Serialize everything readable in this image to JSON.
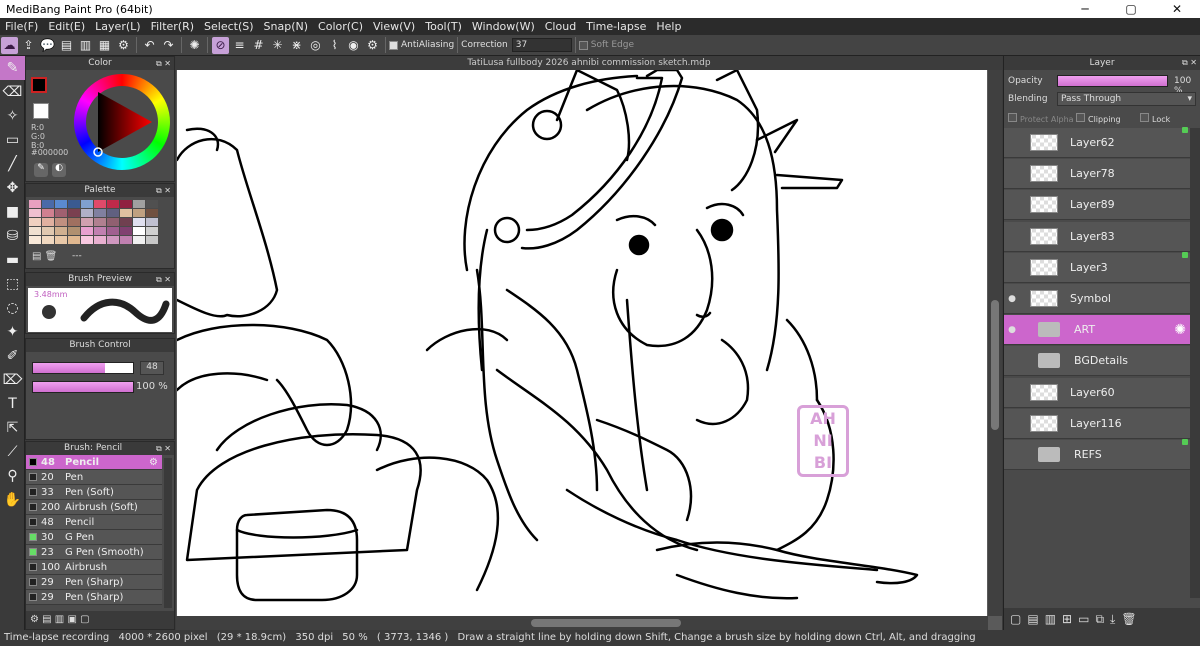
{
  "app": {
    "title": "MediBang Paint Pro (64bit)"
  },
  "menu": [
    "File(F)",
    "Edit(E)",
    "Layer(L)",
    "Filter(R)",
    "Select(S)",
    "Snap(N)",
    "Color(C)",
    "View(V)",
    "Tool(T)",
    "Window(W)",
    "Cloud",
    "Time-lapse",
    "Help"
  ],
  "toolbar": {
    "antialias_label": "AntiAliasing",
    "correction_label": "Correction",
    "correction_value": "37",
    "softedge_label": "Soft Edge"
  },
  "panels": {
    "color": {
      "title": "Color",
      "r": "R:0",
      "g": "G:0",
      "b": "B:0",
      "hex": "#000000"
    },
    "palette": {
      "title": "Palette",
      "more": "---"
    },
    "brush_preview": {
      "title": "Brush Preview",
      "size": "3.48mm"
    },
    "brush_control": {
      "title": "Brush Control",
      "size_value": "48",
      "opacity_value": "100 %"
    },
    "brush_list": {
      "title": "Brush: Pencil"
    }
  },
  "brushes": [
    {
      "size": "48",
      "name": "Pencil",
      "swatch": "#000000",
      "selected": true
    },
    {
      "size": "20",
      "name": "Pen",
      "swatch": "#222222"
    },
    {
      "size": "33",
      "name": "Pen (Soft)",
      "swatch": "#222222"
    },
    {
      "size": "200",
      "name": "Airbrush (Soft)",
      "swatch": "#222222"
    },
    {
      "size": "48",
      "name": "Pencil",
      "swatch": "#222222"
    },
    {
      "size": "30",
      "name": "G Pen",
      "swatch": "#66dd66"
    },
    {
      "size": "23",
      "name": "G Pen (Smooth)",
      "swatch": "#66dd66"
    },
    {
      "size": "100",
      "name": "Airbrush",
      "swatch": "#222222"
    },
    {
      "size": "29",
      "name": "Pen (Sharp)",
      "swatch": "#222222"
    },
    {
      "size": "29",
      "name": "Pen (Sharp)",
      "swatch": "#222222"
    }
  ],
  "canvas": {
    "doc_title": "TatiLusa fullbody 2026 ahnibi commission sketch.mdp",
    "watermark": [
      "AH",
      "NI",
      "BI"
    ]
  },
  "layers_panel": {
    "title": "Layer",
    "opacity_label": "Opacity",
    "opacity_value": "100 %",
    "blending_label": "Blending",
    "blending_value": "Pass Through",
    "protect_alpha": "Protect Alpha",
    "clipping": "Clipping",
    "lock": "Lock"
  },
  "layers": [
    {
      "name": "Layer62",
      "type": "layer",
      "green": true
    },
    {
      "name": "Layer78",
      "type": "layer"
    },
    {
      "name": "Layer89",
      "type": "layer"
    },
    {
      "name": "Layer83",
      "type": "layer"
    },
    {
      "name": "Layer3",
      "type": "layer",
      "green": true
    },
    {
      "name": "Symbol",
      "type": "layer",
      "visible": true
    },
    {
      "name": "ART",
      "type": "folder",
      "visible": true,
      "selected": true
    },
    {
      "name": "BGDetails",
      "type": "folder"
    },
    {
      "name": "Layer60",
      "type": "layer"
    },
    {
      "name": "Layer116",
      "type": "layer"
    },
    {
      "name": "REFS",
      "type": "folder",
      "green": true
    }
  ],
  "status": {
    "mode": "Time-lapse recording",
    "size": "4000 * 2600 pixel",
    "cm": "(29 * 18.9cm)",
    "dpi": "350 dpi",
    "zoom": "50 %",
    "coords": "( 3773, 1346 )",
    "hint": "Draw a straight line by holding down Shift, Change a brush size by holding down Ctrl, Alt, and dragging"
  },
  "colors": {
    "accent": "#cc66cc",
    "primary": "#000000",
    "secondary": "#e0a0e0"
  }
}
